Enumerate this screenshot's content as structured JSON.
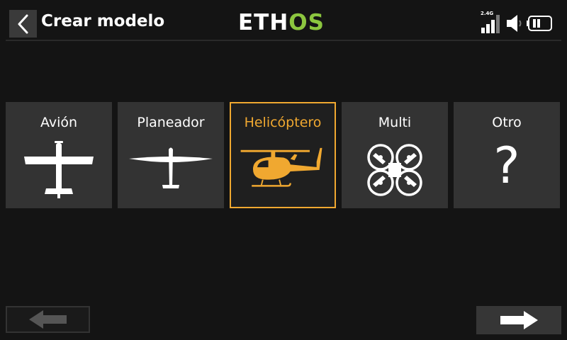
{
  "header": {
    "title": "Crear modelo",
    "brand_prefix": "ETH",
    "brand_suffix": "OS",
    "band_label": "2.4G"
  },
  "colors": {
    "accent": "#f0a830",
    "brand_green": "#8cc63f",
    "tile_bg": "#333333"
  },
  "model_types": [
    {
      "label": "Avión",
      "icon": "airplane-icon",
      "selected": false
    },
    {
      "label": "Planeador",
      "icon": "glider-icon",
      "selected": false
    },
    {
      "label": "Helicóptero",
      "icon": "helicopter-icon",
      "selected": true
    },
    {
      "label": "Multi",
      "icon": "multicopter-icon",
      "selected": false
    },
    {
      "label": "Otro",
      "icon": "question-mark-icon",
      "selected": false,
      "glyph": "?"
    }
  ],
  "footer": {
    "prev_icon": "arrow-left-icon",
    "next_icon": "arrow-right-icon"
  }
}
